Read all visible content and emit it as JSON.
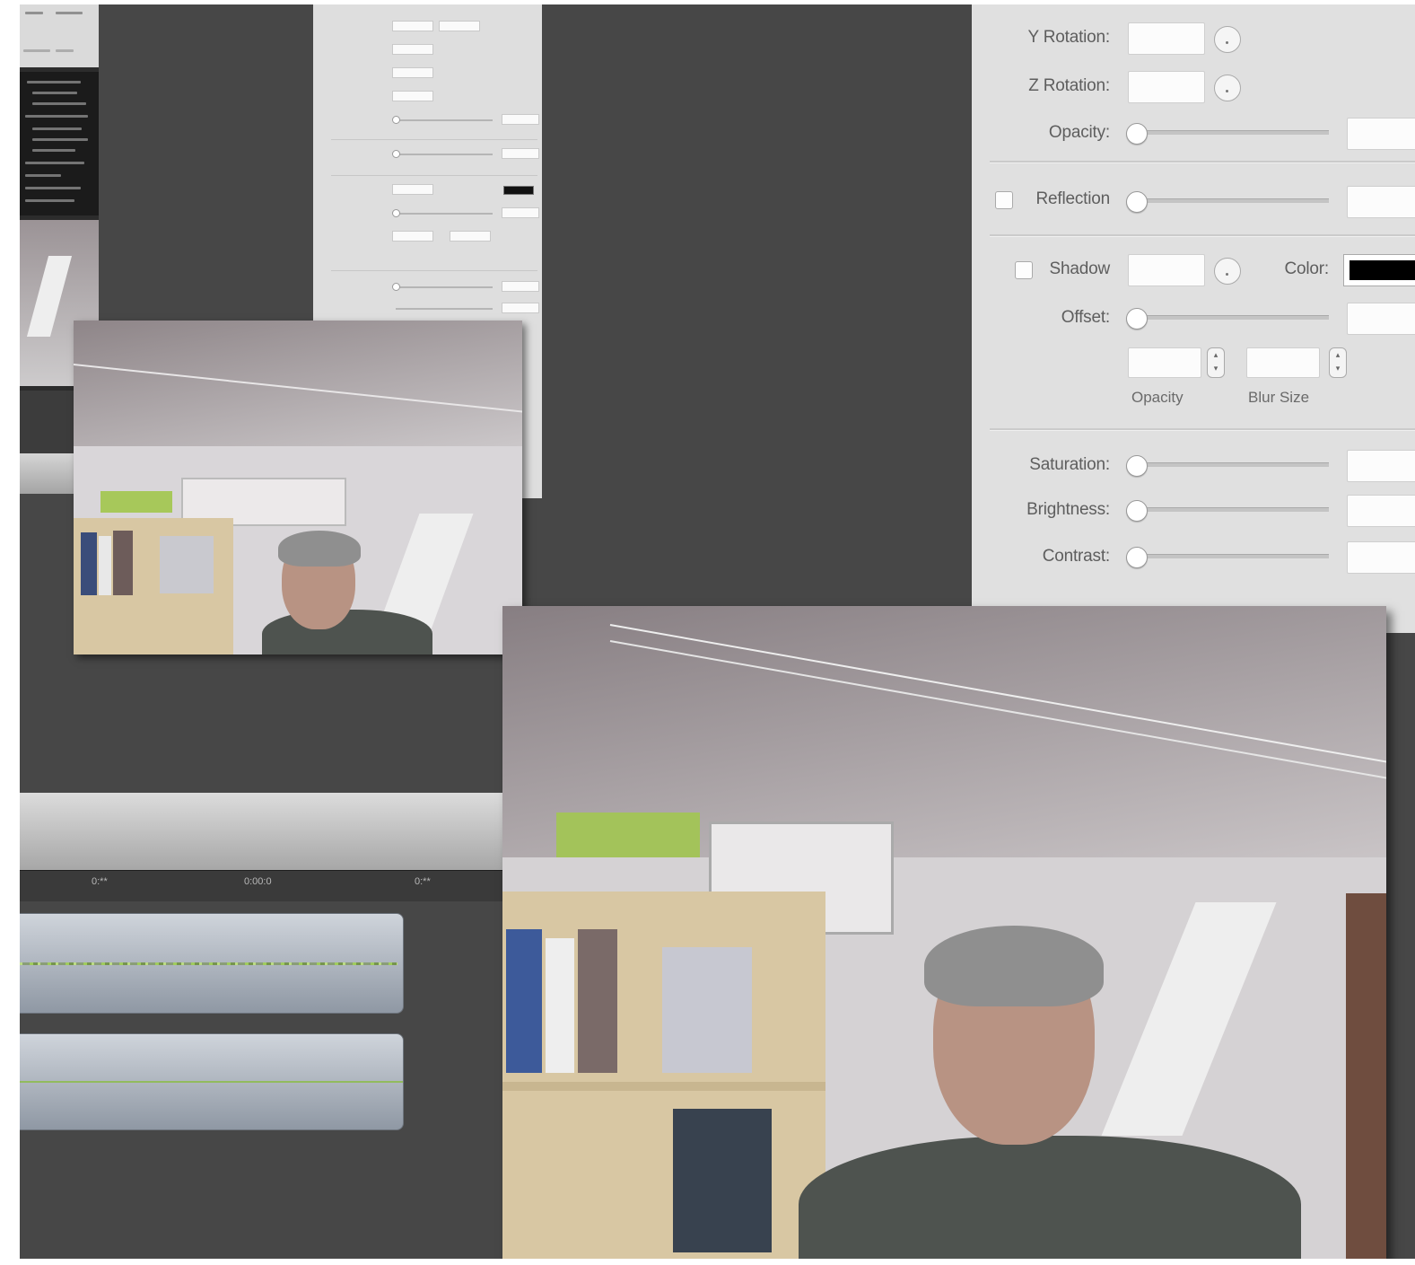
{
  "inspector": {
    "y_rotation_label": "Y Rotation:",
    "z_rotation_label": "Z Rotation:",
    "opacity_label": "Opacity:",
    "reflection_label": "Reflection",
    "shadow_label": "Shadow",
    "color_label": "Color:",
    "offset_label": "Offset:",
    "shadow_opacity_caption": "Opacity",
    "blur_size_caption": "Blur Size",
    "saturation_label": "Saturation:",
    "brightness_label": "Brightness:",
    "contrast_label": "Contrast:",
    "shadow_color": "#000000"
  },
  "timeline": {
    "ruler_labels": [
      "0:**",
      "0:00:0",
      "0:**"
    ]
  },
  "colors": {
    "canvas": "#474747",
    "panel": "#e0e0e0",
    "clip": "#a9b0ba",
    "waveform": "#9ed04c"
  }
}
